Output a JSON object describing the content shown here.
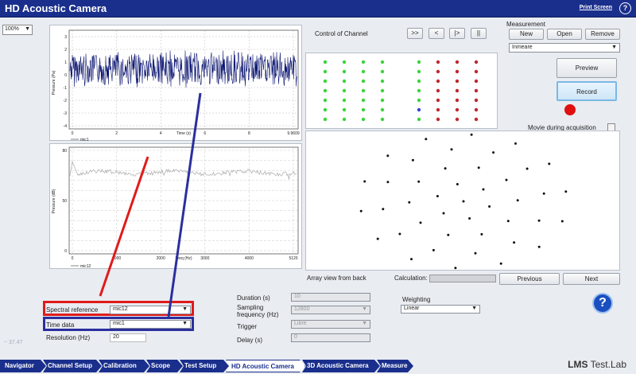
{
  "window": {
    "title": "HD Acoustic Camera",
    "print_screen": "Print Screen",
    "help": "?"
  },
  "zoom": "100%",
  "time_plot": {
    "ylabel": "Pressure (Pa)",
    "xlabel": "Time (s)",
    "yticks": [
      "3",
      "2",
      "1",
      "0",
      "-1",
      "-2",
      "-3",
      "-4"
    ],
    "xticks": [
      "0",
      "2",
      "4",
      "6",
      "8",
      "9.9609"
    ],
    "legend": "mic1"
  },
  "spec_plot": {
    "ylabel": "Pressure (dB)",
    "xlabel": "Freq (Hz)",
    "yticks": [
      "80",
      "",
      "",
      "",
      "",
      "50",
      "",
      "",
      "",
      "",
      "0"
    ],
    "xticks": [
      "0",
      "1000",
      "2000",
      "3000",
      "4000",
      "5120"
    ],
    "legend": "mic12"
  },
  "channel_control": {
    "label": "Control of Channel",
    "buttons": [
      ">>",
      "<",
      "|>",
      "||"
    ]
  },
  "measurement": {
    "label": "Measurement",
    "new": "New",
    "open": "Open",
    "remove": "Remove",
    "selected": "Inmeare"
  },
  "preview": "Preview",
  "record": "Record",
  "movie_during_acquisition": "Movie during acquisition",
  "array_view_label": "Array view from back",
  "calculation_label": "Calculation:",
  "previous": "Previous",
  "next": "Next",
  "spectral_reference": {
    "label": "Spectral reference",
    "value": "mic12"
  },
  "time_data": {
    "label": "Time data",
    "value": "mic1"
  },
  "resolution": {
    "label": "Resolution (Hz)",
    "value": "20"
  },
  "duration": {
    "label": "Duration (s)",
    "value": "10"
  },
  "sampling": {
    "label1": "Sampling",
    "label2": "frequency (Hz)",
    "value": "12800"
  },
  "trigger": {
    "label": "Trigger",
    "value": "Libre"
  },
  "delay": {
    "label": "Delay (s)",
    "value": "0"
  },
  "weighting": {
    "label": "Weighting",
    "value": "Linear"
  },
  "left_status": "~ 37.47",
  "tabs": [
    "Navigator",
    "Channel Setup",
    "Calibration",
    "Scope",
    "Test Setup",
    "HD Acoustic Camera",
    "3D Acoustic Camera",
    "Measure"
  ],
  "brand": {
    "a": "LMS",
    "b": "Test.Lab"
  },
  "colors": {
    "title_bar": "#1a2f8c",
    "spectral_box": "#e01b1b",
    "time_box": "#2a2f9e",
    "green_dot": "#3bd43b",
    "red_dot": "#c0272d",
    "blue_dot": "#3344dd"
  }
}
